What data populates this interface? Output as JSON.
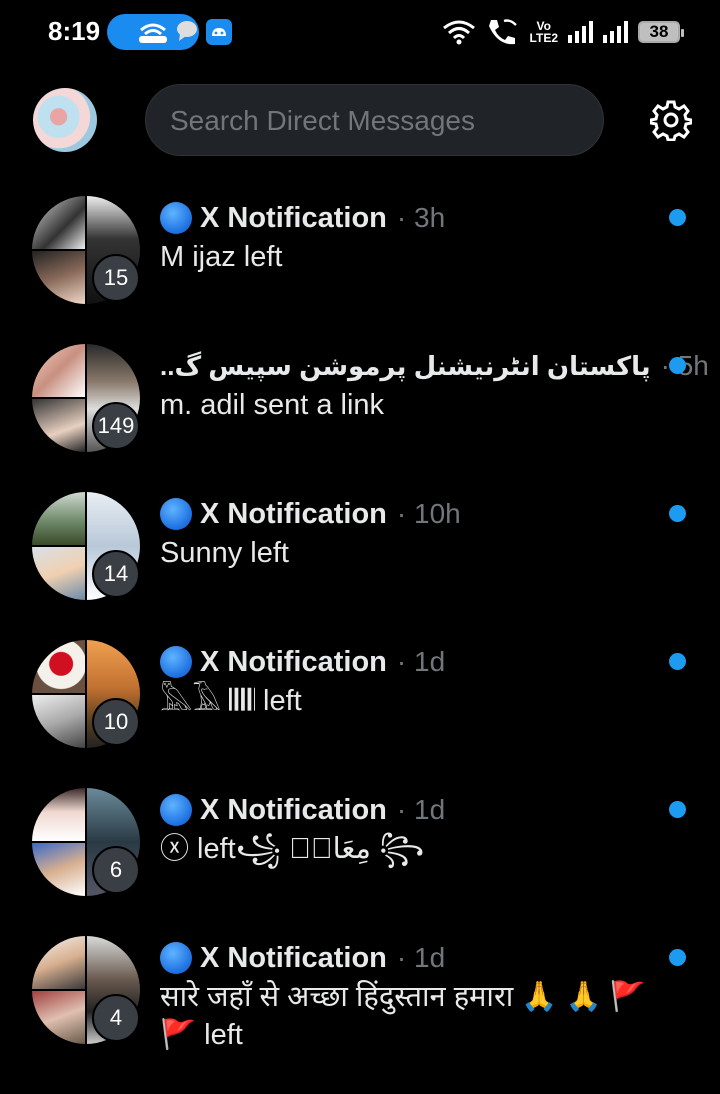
{
  "status_bar": {
    "time": "8:19",
    "volte_top": "Vo",
    "volte_bottom": "LTE2",
    "battery": "38",
    "colors": {
      "hotspot_pill": "#1a8cf0"
    }
  },
  "header": {
    "search_placeholder": "Search Direct Messages",
    "settings_icon": "gear-icon"
  },
  "conversations": [
    {
      "name": "X Notification",
      "time": "· 3h",
      "preview": "M ijaz left",
      "members_extra": "15",
      "unread": true,
      "name_prefix_icons": [
        "blue-circle-emoji",
        "x-logo"
      ]
    },
    {
      "name": "پاکستان انٹرنیشنل پرموشن سپیس گ..",
      "time": "· 5h",
      "preview": "m. adil sent a link",
      "members_extra": "149",
      "unread": true,
      "name_prefix_icons": []
    },
    {
      "name": "X Notification",
      "time": "· 10h",
      "preview": "Sunny left",
      "members_extra": "14",
      "unread": true,
      "name_prefix_icons": [
        "blue-circle-emoji",
        "x-logo"
      ]
    },
    {
      "name": "X Notification",
      "time": "· 1d",
      "preview": "𓅓𓄿 𝄃𝄃𝄃𝄃 left",
      "members_extra": "10",
      "unread": true,
      "name_prefix_icons": [
        "blue-circle-emoji",
        "x-logo"
      ]
    },
    {
      "name": "X Notification",
      "time": "· 1d",
      "preview": "ⓧ left꧁ مِعَاذٖ ꧂",
      "members_extra": "6",
      "unread": true,
      "name_prefix_icons": [
        "blue-circle-emoji",
        "x-logo"
      ]
    },
    {
      "name": "X Notification",
      "time": "· 1d",
      "preview": "सारे जहाँ से अच्छा हिंदुस्तान हमारा 🙏 🙏 🚩🚩 left",
      "members_extra": "4",
      "unread": true,
      "name_prefix_icons": [
        "blue-circle-emoji",
        "x-logo"
      ]
    }
  ],
  "colors": {
    "background": "#000000",
    "text_primary": "#e7e9ea",
    "text_secondary": "#71767b",
    "accent": "#1d9bf0"
  }
}
